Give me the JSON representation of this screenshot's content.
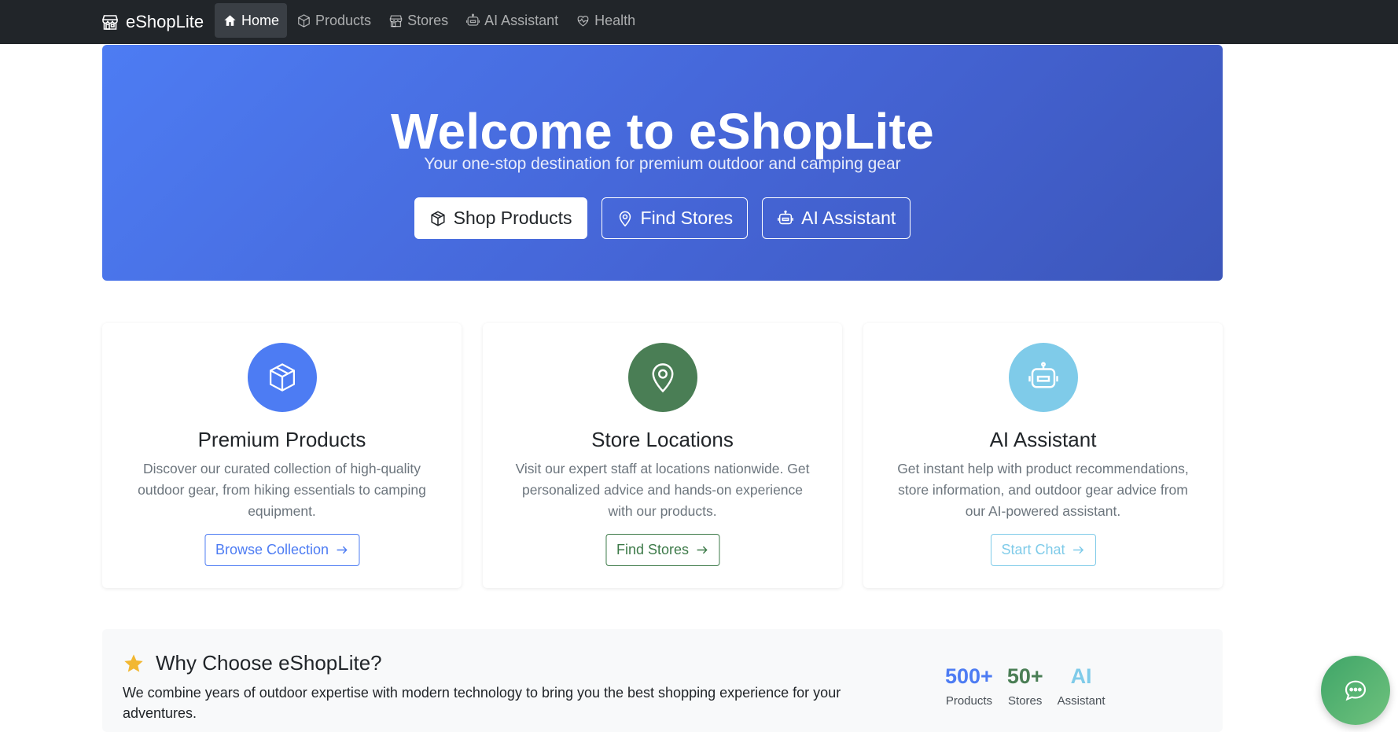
{
  "navbar": {
    "brand": "eShopLite",
    "brand_icon": "shop-icon",
    "items": [
      {
        "label": "Home",
        "icon": "house-icon",
        "active": true
      },
      {
        "label": "Products",
        "icon": "box-icon",
        "active": false
      },
      {
        "label": "Stores",
        "icon": "shop-icon",
        "active": false
      },
      {
        "label": "AI Assistant",
        "icon": "robot-icon",
        "active": false
      },
      {
        "label": "Health",
        "icon": "heart-pulse-icon",
        "active": false
      }
    ]
  },
  "hero": {
    "title": "Welcome to eShopLite",
    "subtitle": "Your one-stop destination for premium outdoor and camping gear",
    "buttons": [
      {
        "label": "Shop Products",
        "icon": "box-icon"
      },
      {
        "label": "Find Stores",
        "icon": "geo-alt-icon"
      },
      {
        "label": "AI Assistant",
        "icon": "robot-icon"
      }
    ]
  },
  "features": [
    {
      "title": "Premium Products",
      "text": "Discover our curated collection of high-quality outdoor gear, from hiking essentials to camping equipment.",
      "button": "Browse Collection",
      "icon": "box-icon",
      "color": "#4d7cf3"
    },
    {
      "title": "Store Locations",
      "text": "Visit our expert staff at locations nationwide. Get personalized advice and hands-on experience with our products.",
      "button": "Find Stores",
      "icon": "geo-alt-icon",
      "color": "#4a7e55"
    },
    {
      "title": "AI Assistant",
      "text": "Get instant help with product recommendations, store information, and outdoor gear advice from our AI-powered assistant.",
      "button": "Start Chat",
      "icon": "robot-icon",
      "color": "#7fcbe9"
    }
  ],
  "why": {
    "title": "Why Choose eShopLite?",
    "icon": "star-icon",
    "text": "We combine years of outdoor expertise with modern technology to bring you the best shopping experience for your adventures.",
    "stats": [
      {
        "value": "500+",
        "label": "Products",
        "color": "#4d7cf3"
      },
      {
        "value": "50+",
        "label": "Stores",
        "color": "#4a7e55"
      },
      {
        "value": "AI",
        "label": "Assistant",
        "color": "#7fcbe9"
      }
    ]
  },
  "chat_fab": {
    "icon": "chat-dots-icon"
  }
}
